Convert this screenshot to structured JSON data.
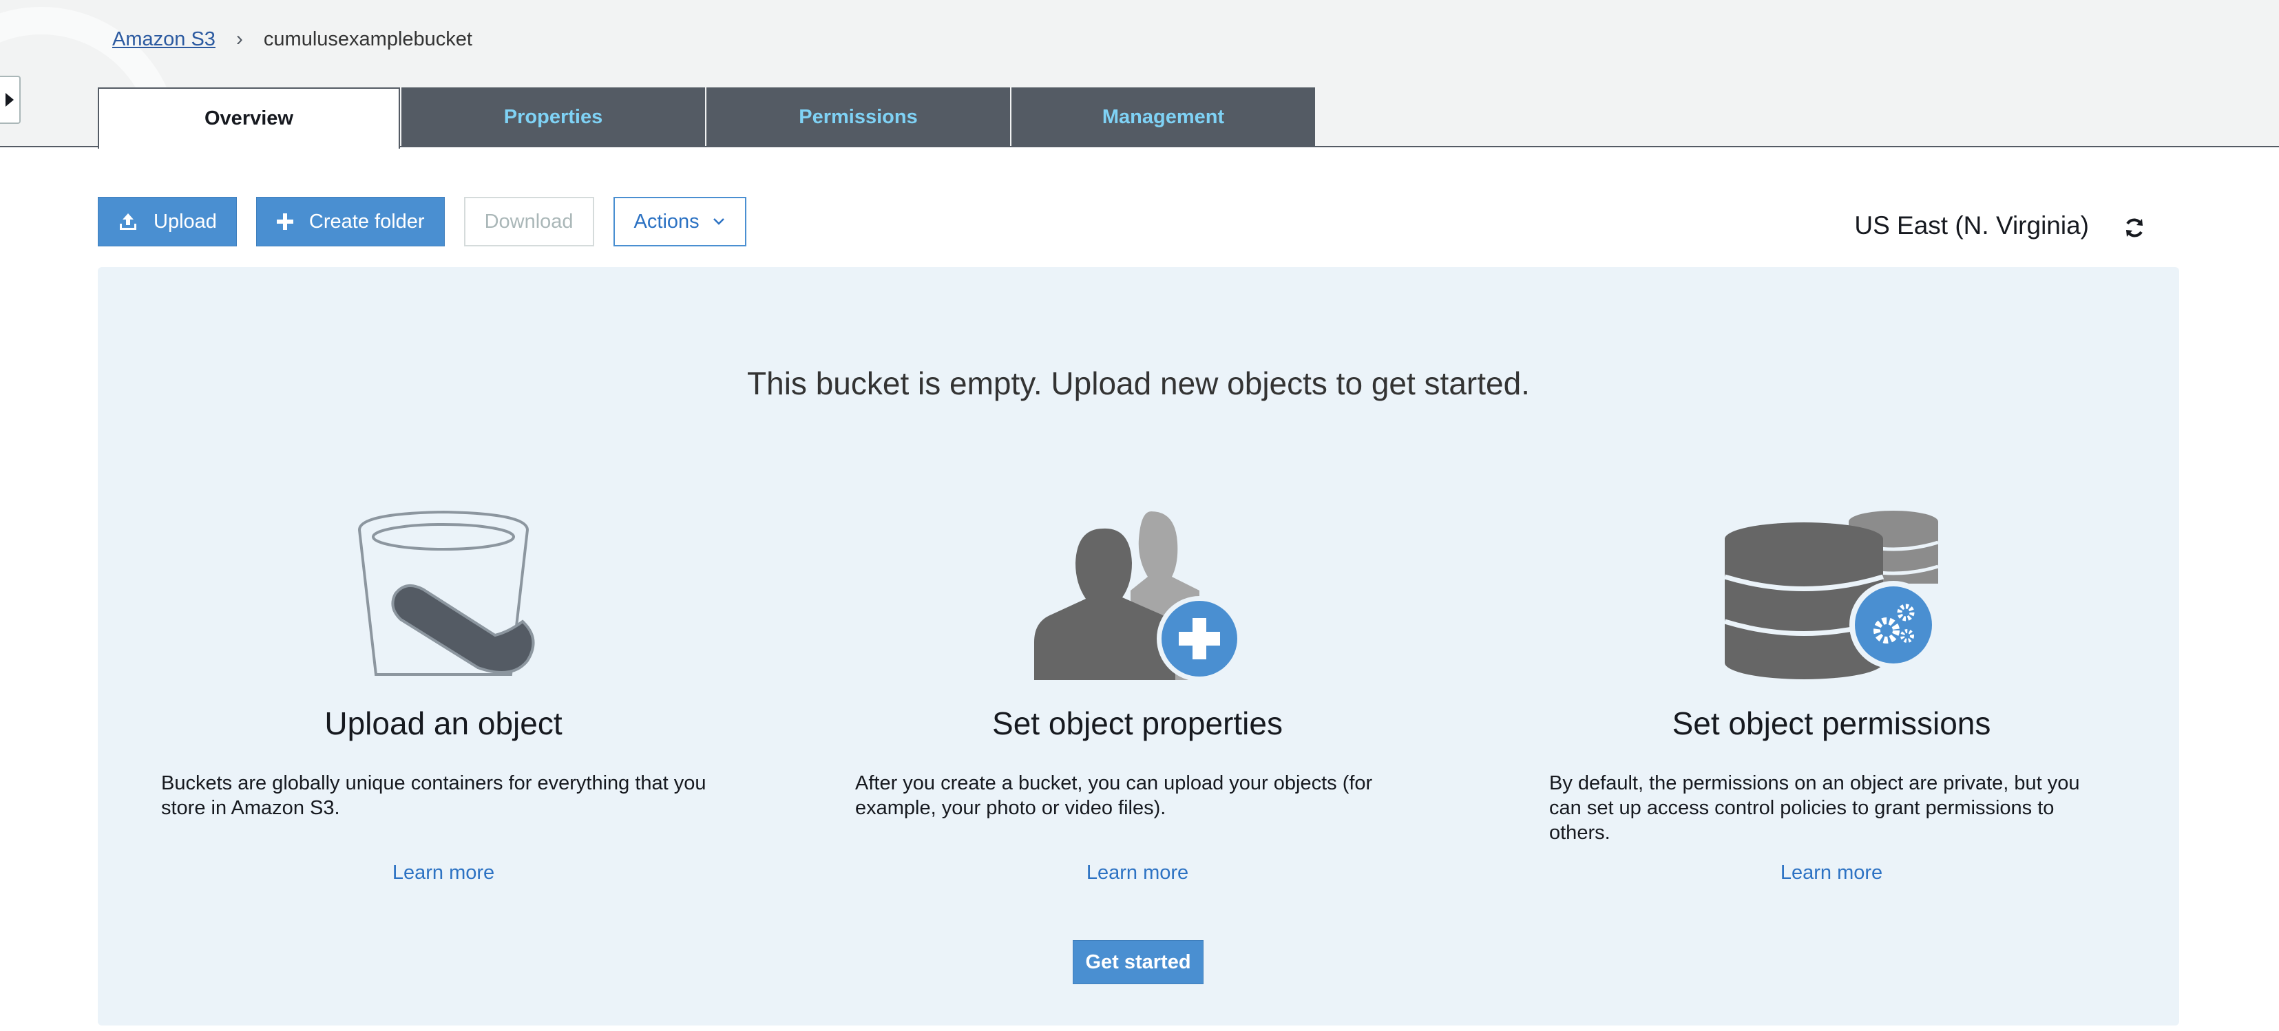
{
  "breadcrumb": {
    "root": "Amazon S3",
    "separator": "›",
    "current": "cumulusexamplebucket"
  },
  "tabs": [
    {
      "label": "Overview",
      "active": true
    },
    {
      "label": "Properties",
      "active": false
    },
    {
      "label": "Permissions",
      "active": false
    },
    {
      "label": "Management",
      "active": false
    }
  ],
  "toolbar": {
    "upload": "Upload",
    "create_folder": "Create folder",
    "download": "Download",
    "actions": "Actions"
  },
  "region": "US East (N. Virginia)",
  "empty_state": {
    "message": "This bucket is empty. Upload new objects to get started.",
    "columns": [
      {
        "icon": "bucket-icon",
        "title": "Upload an object",
        "description": "Buckets are globally unique containers for everything that you store in Amazon S3.",
        "link": "Learn more"
      },
      {
        "icon": "users-add-icon",
        "title": "Set object properties",
        "description": "After you create a bucket, you can upload your objects (for example, your photo or video files).",
        "link": "Learn more"
      },
      {
        "icon": "database-gear-icon",
        "title": "Set object permissions",
        "description": "By default, the permissions on an object are private, but you can set up access control policies to grant permissions to others.",
        "link": "Learn more"
      }
    ],
    "get_started": "Get started"
  },
  "colors": {
    "accent": "#4a8fd1",
    "tab_bg": "#545b64",
    "tab_text": "#7fd2f5",
    "panel_bg": "#ebf3f9"
  }
}
